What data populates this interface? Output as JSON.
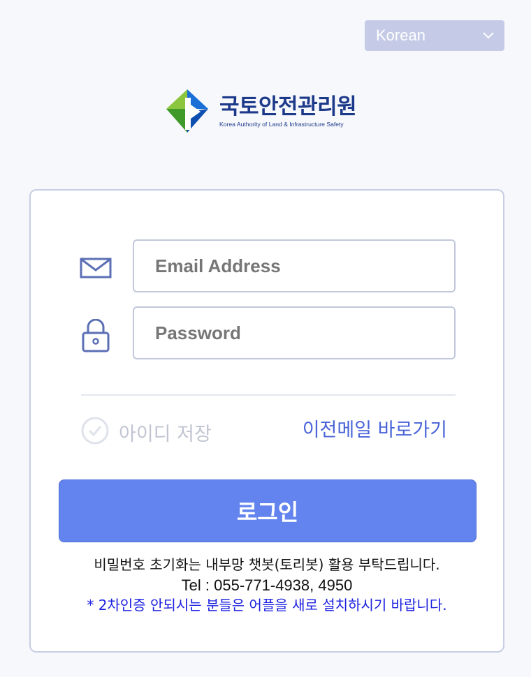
{
  "header": {
    "language_select": {
      "value": "Korean"
    }
  },
  "logo": {
    "name_ko": "국토안전관리원",
    "name_en": "Korea Authority of Land & Infrastructure Safety",
    "colors": {
      "navy": "#1d3a8a",
      "green": "#5cb531",
      "blue": "#1a6fd6"
    }
  },
  "login": {
    "email_placeholder": "Email Address",
    "email_icon": "envelope-icon",
    "password_placeholder": "Password",
    "password_icon": "lock-icon",
    "remember_label": "아이디 저장",
    "remember_checked": false,
    "prev_mail_link": "이전메일 바로가기",
    "login_button": "로그인",
    "accent_color": "#6384ee"
  },
  "notes": {
    "line1": "비밀번호 초기화는 내부망 챗봇(토리봇) 활용 부탁드립니다.",
    "line2": "Tel : 055-771-4938, 4950",
    "line3": "* 2차인증 안되시는 분들은 어플을 새로 설치하시기 바랍니다."
  }
}
